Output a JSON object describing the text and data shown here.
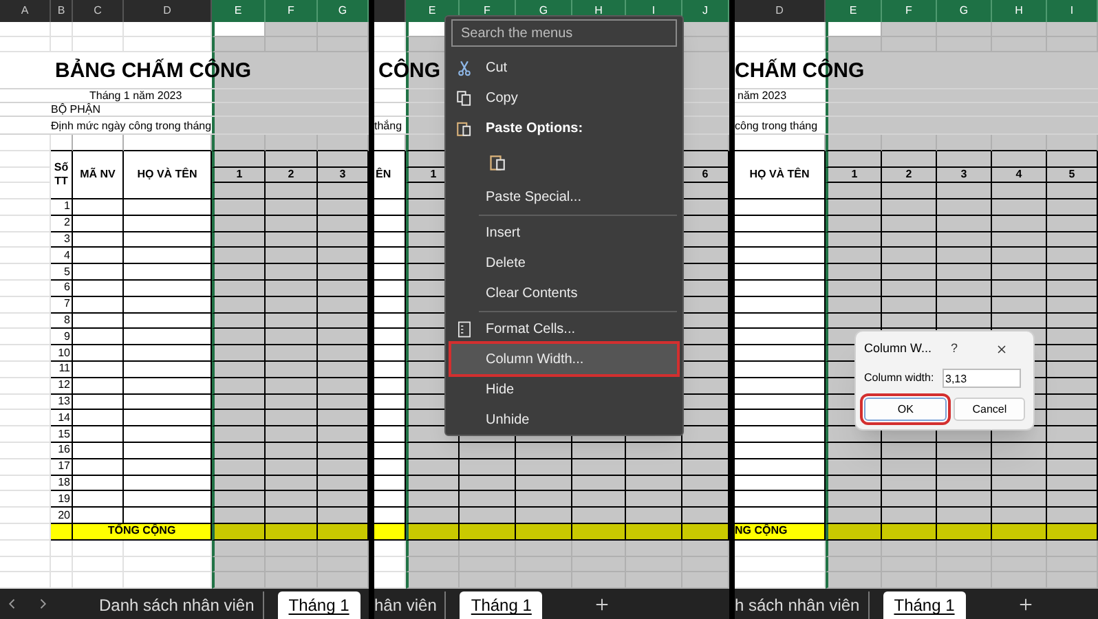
{
  "panels": [
    {
      "column_headers": [
        {
          "label": "A",
          "selected": false
        },
        {
          "label": "B",
          "selected": false
        },
        {
          "label": "C",
          "selected": false
        },
        {
          "label": "D",
          "selected": false
        },
        {
          "label": "E",
          "selected": true
        },
        {
          "label": "F",
          "selected": true
        },
        {
          "label": "G",
          "selected": true
        }
      ],
      "title": "BẢNG CHẤM CÔNG",
      "month": "Tháng 1 năm 2023",
      "department": "BỘ PHẬN",
      "quota": "Định mức ngày công trong tháng",
      "table_headers": [
        "Số TT",
        "MÃ NV",
        "HỌ VÀ TÊN"
      ],
      "day_headers": [
        "1",
        "2",
        "3"
      ],
      "row_numbers": [
        "1",
        "2",
        "3",
        "4",
        "5",
        "6",
        "7",
        "8",
        "9",
        "10",
        "11",
        "12",
        "13",
        "14",
        "15",
        "16",
        "17",
        "18",
        "19",
        "20"
      ],
      "total": "TỔNG CỘNG",
      "sheet_tabs": [
        {
          "label": "Danh sách nhân viên",
          "selected": false
        },
        {
          "label": "Tháng 1",
          "selected": true
        }
      ]
    },
    {
      "column_headers": [
        {
          "selected": false
        },
        {
          "label": "E",
          "selected": true
        },
        {
          "label": "F",
          "selected": true
        },
        {
          "label": "G",
          "selected": true
        },
        {
          "label": "H",
          "selected": true
        },
        {
          "label": "I",
          "selected": true
        },
        {
          "label": "J",
          "selected": true
        }
      ],
      "title": "CÔNG",
      "quota": "thắng",
      "table_headers": [
        "ÊN"
      ],
      "day_headers": [
        "1",
        "6"
      ],
      "sheet_tabs": [
        {
          "label": "hân viên",
          "selected": false
        },
        {
          "label": "Tháng 1",
          "selected": true
        }
      ],
      "context_menu": {
        "search": {
          "placeholder": "Search the menus"
        },
        "items": [
          {
            "kind": "item",
            "label": "Cut",
            "selected": false
          },
          {
            "kind": "item",
            "label": "Copy",
            "selected": false
          },
          {
            "kind": "heading",
            "label": "Paste Options:"
          },
          {
            "kind": "paste_icon"
          },
          {
            "kind": "item",
            "label": "Paste Special...",
            "selected": false
          },
          {
            "kind": "separator"
          },
          {
            "kind": "item",
            "label": "Insert",
            "selected": false
          },
          {
            "kind": "item",
            "label": "Delete",
            "selected": false
          },
          {
            "kind": "item",
            "label": "Clear Contents",
            "selected": false
          },
          {
            "kind": "separator"
          },
          {
            "kind": "item",
            "label": "Format Cells...",
            "selected": false
          },
          {
            "kind": "item",
            "label": "Column Width...",
            "selected": true
          },
          {
            "kind": "item",
            "label": "Hide",
            "selected": false
          },
          {
            "kind": "item",
            "label": "Unhide",
            "selected": false
          }
        ]
      }
    },
    {
      "column_headers": [
        {
          "label": "D",
          "selected": false
        },
        {
          "label": "E",
          "selected": true
        },
        {
          "label": "F",
          "selected": true
        },
        {
          "label": "G",
          "selected": true
        },
        {
          "label": "H",
          "selected": true
        },
        {
          "label": "I",
          "selected": true
        }
      ],
      "title": "CHẤM CÔNG",
      "month": "năm 2023",
      "quota": "công trong tháng",
      "table_headers": [
        "HỌ VÀ TÊN"
      ],
      "day_headers": [
        "1",
        "2",
        "3",
        "4",
        "5"
      ],
      "total": "NG CỘNG",
      "sheet_tabs": [
        {
          "label": "h sách nhân viên",
          "selected": false
        },
        {
          "label": "Tháng 1",
          "selected": true
        }
      ],
      "dialog": {
        "title": "Column W...",
        "help": "?",
        "field": {
          "label": "Column width:",
          "value": "3,13"
        },
        "buttons": [
          {
            "label": "OK",
            "selected": true
          },
          {
            "label": "Cancel",
            "selected": false
          }
        ]
      }
    }
  ]
}
